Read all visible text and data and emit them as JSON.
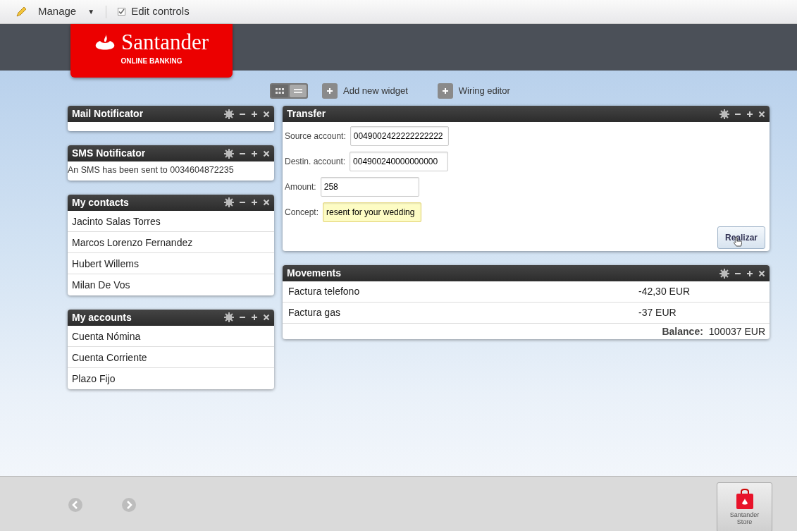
{
  "toolbar": {
    "manage": "Manage",
    "manage_caret": "▼",
    "edit_controls": {
      "label": "Edit controls",
      "checked": true
    }
  },
  "logo": {
    "name": "Santander",
    "subtitle": "ONLINE BANKING"
  },
  "view_toggle": [
    {
      "kind": "grid",
      "selected": false
    },
    {
      "kind": "list",
      "selected": true
    }
  ],
  "actions": [
    "Add new widget",
    "Wiring editor"
  ],
  "left_widgets": [
    {
      "kind": "empty",
      "title": "Mail Notificator"
    },
    {
      "kind": "message",
      "title": "SMS Notificator",
      "text": "An SMS has been sent to 0034604872235"
    },
    {
      "kind": "list",
      "title": "My contacts",
      "items": [
        "Jacinto Salas Torres",
        "Marcos Lorenzo Fernandez",
        "Hubert Willems",
        "Milan De Vos"
      ]
    },
    {
      "kind": "list",
      "title": "My accounts",
      "items": [
        "Cuenta Nómina",
        "Cuenta Corriente",
        "Plazo Fijo"
      ]
    }
  ],
  "right_widgets": [
    {
      "kind": "form",
      "title": "Transfer",
      "fields": [
        {
          "label": "Source account:",
          "value": "0049002422222222222",
          "focused": false
        },
        {
          "label": "Destin. account:",
          "value": "004900240000000000",
          "focused": false
        },
        {
          "label": "Amount:",
          "value": "258",
          "focused": false
        },
        {
          "label": "Concept:",
          "value": "resent for your wedding",
          "focused": true
        }
      ],
      "submit": "Realizar"
    },
    {
      "kind": "table",
      "title": "Movements",
      "rows": [
        {
          "concept": "Factura telefono",
          "amount": "-42,30 EUR"
        },
        {
          "concept": "Factura gas",
          "amount": "-37 EUR"
        }
      ],
      "balance_label": "Balance:",
      "balance": "100037 EUR"
    }
  ],
  "footer": {
    "store": "Santander Store"
  }
}
